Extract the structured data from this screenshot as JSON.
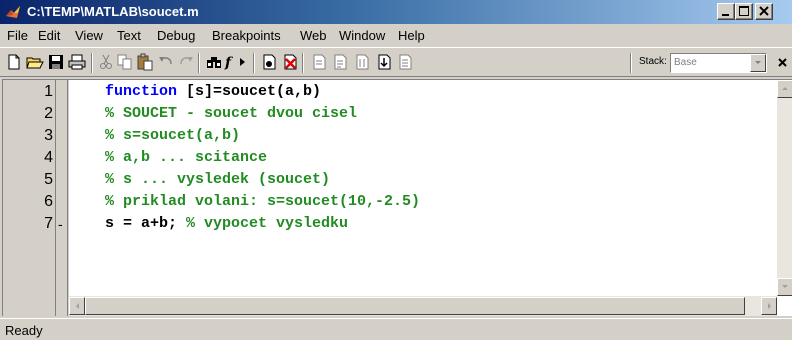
{
  "window": {
    "title": "C:\\TEMP\\MATLAB\\soucet.m"
  },
  "menu": {
    "items": [
      {
        "label": "File"
      },
      {
        "label": "Edit"
      },
      {
        "label": "View"
      },
      {
        "label": "Text"
      },
      {
        "label": "Debug"
      },
      {
        "label": "Breakpoints"
      },
      {
        "label": "Web"
      },
      {
        "label": "Window"
      },
      {
        "label": "Help"
      }
    ]
  },
  "toolbar": {
    "icons": [
      "new-file-icon",
      "open-folder-icon",
      "save-icon",
      "print-icon",
      "cut-icon",
      "copy-icon",
      "paste-icon",
      "undo-icon",
      "redo-icon",
      "find-icon",
      "function-icon",
      "set-breakpoint-icon",
      "clear-breakpoints-icon",
      "step-icon",
      "step-in-icon",
      "step-out-icon",
      "continue-icon",
      "exit-debug-icon"
    ],
    "stack_label": "Stack:",
    "stack_value": "Base"
  },
  "editor": {
    "lines": [
      {
        "num": "1",
        "dash": "",
        "parts": [
          {
            "cls": "kw",
            "text": "function"
          },
          {
            "cls": "tx",
            "text": " [s]=soucet(a,b)"
          }
        ]
      },
      {
        "num": "2",
        "dash": "",
        "parts": [
          {
            "cls": "cm",
            "text": "% SOUCET - soucet dvou cisel"
          }
        ]
      },
      {
        "num": "3",
        "dash": "",
        "parts": [
          {
            "cls": "cm",
            "text": "% s=soucet(a,b)"
          }
        ]
      },
      {
        "num": "4",
        "dash": "",
        "parts": [
          {
            "cls": "cm",
            "text": "% a,b ... scitance"
          }
        ]
      },
      {
        "num": "5",
        "dash": "",
        "parts": [
          {
            "cls": "cm",
            "text": "% s ... vysledek (soucet)"
          }
        ]
      },
      {
        "num": "6",
        "dash": "",
        "parts": [
          {
            "cls": "cm",
            "text": "% priklad volani: s=soucet(10,-2.5)"
          }
        ]
      },
      {
        "num": "7",
        "dash": "-",
        "parts": [
          {
            "cls": "tx",
            "text": "s = a+b; "
          },
          {
            "cls": "cm",
            "text": "% vypocet vysledku"
          }
        ]
      }
    ]
  },
  "status": {
    "text": "Ready"
  },
  "colors": {
    "keyword": "#0000ff",
    "comment": "#228b22",
    "titlebar_start": "#0a246a",
    "titlebar_end": "#a6caf0"
  }
}
